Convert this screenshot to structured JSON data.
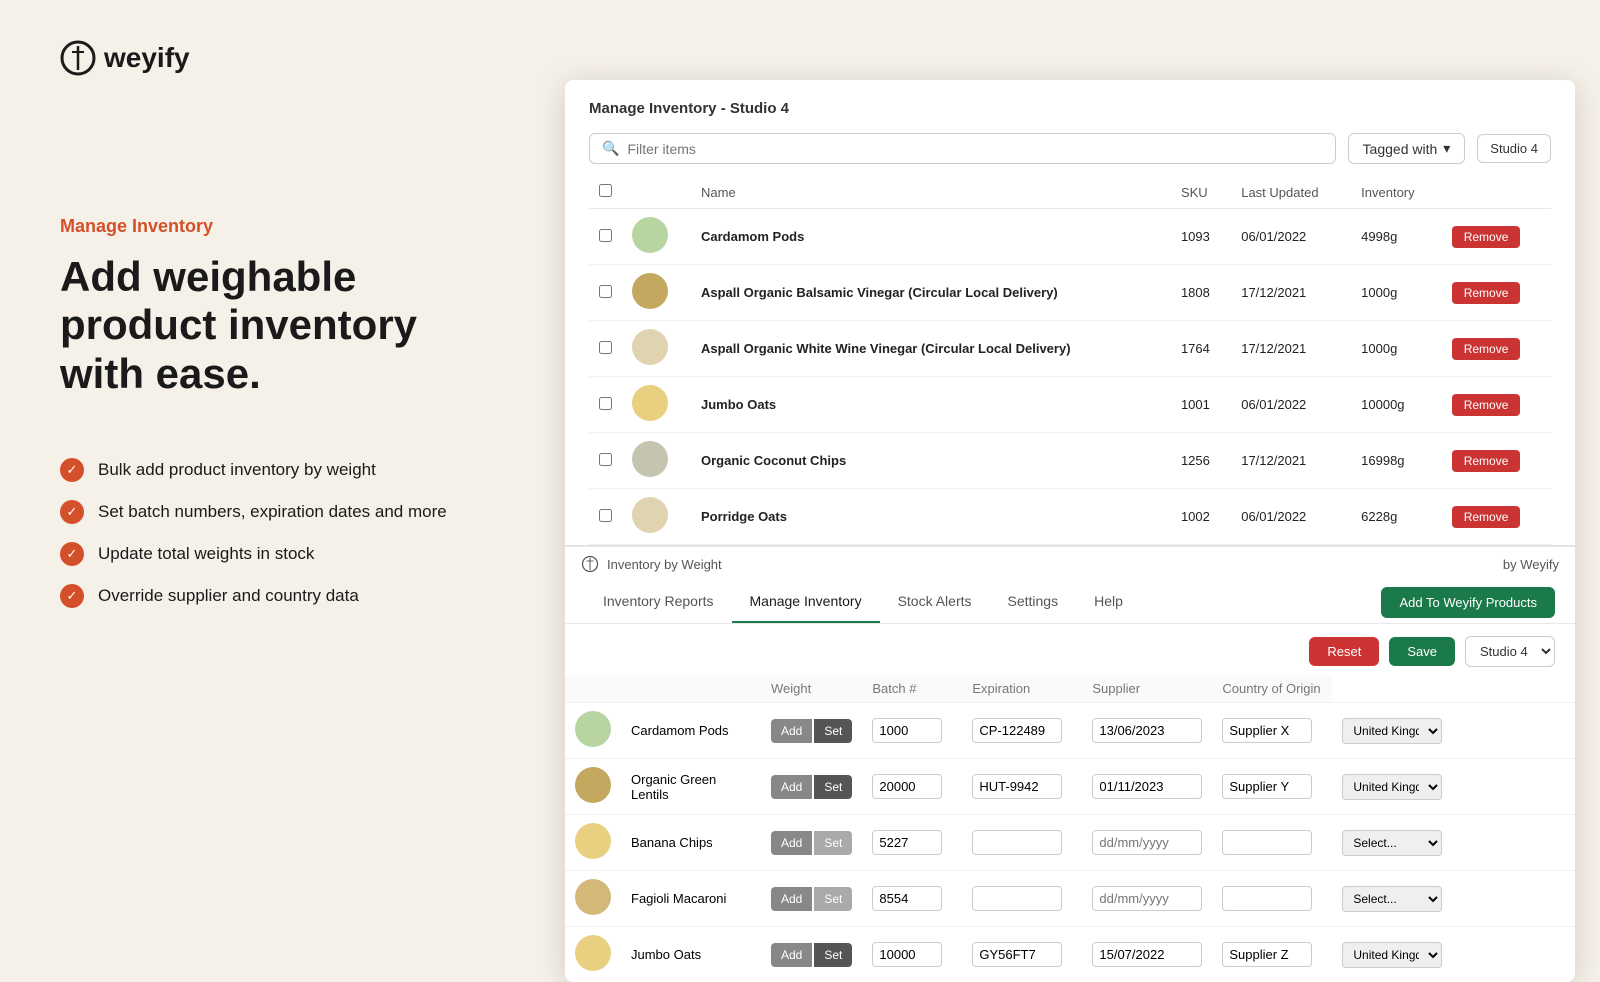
{
  "logo": {
    "text": "weyify",
    "icon": "⊘"
  },
  "left": {
    "section_label": "Manage Inventory",
    "headline": "Add weighable product inventory with ease.",
    "features": [
      "Bulk add product inventory by weight",
      "Set batch numbers, expiration dates and more",
      "Update total weights in stock",
      "Override supplier and country data"
    ]
  },
  "app": {
    "top_panel": {
      "title": "Manage Inventory - Studio 4",
      "filter_placeholder": "Filter items",
      "tagged_with": "Tagged with",
      "studio_label": "Studio 4",
      "columns": [
        "Name",
        "SKU",
        "Last Updated",
        "Inventory"
      ],
      "rows": [
        {
          "name": "Cardamom Pods",
          "sku": "1093",
          "last_updated": "06/01/2022",
          "inventory": "4998g",
          "img_class": "ci-green"
        },
        {
          "name": "Aspall Organic Balsamic Vinegar (Circular Local Delivery)",
          "sku": "1808",
          "last_updated": "17/12/2021",
          "inventory": "1000g",
          "img_class": "ci-brown"
        },
        {
          "name": "Aspall Organic White Wine Vinegar (Circular Local Delivery)",
          "sku": "1764",
          "last_updated": "17/12/2021",
          "inventory": "1000g",
          "img_class": "ci-cream"
        },
        {
          "name": "Jumbo Oats",
          "sku": "1001",
          "last_updated": "06/01/2022",
          "inventory": "10000g",
          "img_class": "ci-yellow"
        },
        {
          "name": "Organic Coconut Chips",
          "sku": "1256",
          "last_updated": "17/12/2021",
          "inventory": "16998g",
          "img_class": "ci-grey"
        },
        {
          "name": "Porridge Oats",
          "sku": "1002",
          "last_updated": "06/01/2022",
          "inventory": "6228g",
          "img_class": "ci-cream"
        }
      ],
      "remove_label": "Remove"
    },
    "weyify_bar": {
      "title": "Inventory by Weight",
      "by": "by Weyify"
    },
    "bottom_panel": {
      "tabs": [
        {
          "label": "Inventory Reports",
          "active": false
        },
        {
          "label": "Manage Inventory",
          "active": true
        },
        {
          "label": "Stock Alerts",
          "active": false
        },
        {
          "label": "Settings",
          "active": false
        },
        {
          "label": "Help",
          "active": false
        }
      ],
      "add_products_btn": "Add To Weyify Products",
      "reset_label": "Reset",
      "save_label": "Save",
      "studio_select": "Studio 4",
      "columns": [
        "",
        "",
        "Weight",
        "Batch #",
        "Expiration",
        "Supplier",
        "Country of Origin"
      ],
      "rows": [
        {
          "name": "Cardamom Pods",
          "img_class": "ci-green",
          "weight": "1000",
          "batch": "CP-122489",
          "expiration": "13/06/2023",
          "supplier": "Supplier X",
          "country": "United Kingd...",
          "has_data": true
        },
        {
          "name": "Organic Green Lentils",
          "img_class": "ci-brown",
          "weight": "20000",
          "batch": "HUT-9942",
          "expiration": "01/11/2023",
          "supplier": "Supplier Y",
          "country": "United Kingd...",
          "has_data": true
        },
        {
          "name": "Banana Chips",
          "img_class": "ci-yellow",
          "weight": "5227",
          "batch": "",
          "expiration": "",
          "supplier": "",
          "country": "",
          "has_data": false
        },
        {
          "name": "Fagioli Macaroni",
          "img_class": "ci-tan",
          "weight": "8554",
          "batch": "",
          "expiration": "",
          "supplier": "",
          "country": "",
          "has_data": false
        },
        {
          "name": "Jumbo Oats",
          "img_class": "ci-yellow",
          "weight": "10000",
          "batch": "GY56FT7",
          "expiration": "15/07/2022",
          "supplier": "Supplier Z",
          "country": "United Kingd...",
          "has_data": true
        }
      ],
      "add_label": "Add",
      "set_label": "Set"
    }
  }
}
